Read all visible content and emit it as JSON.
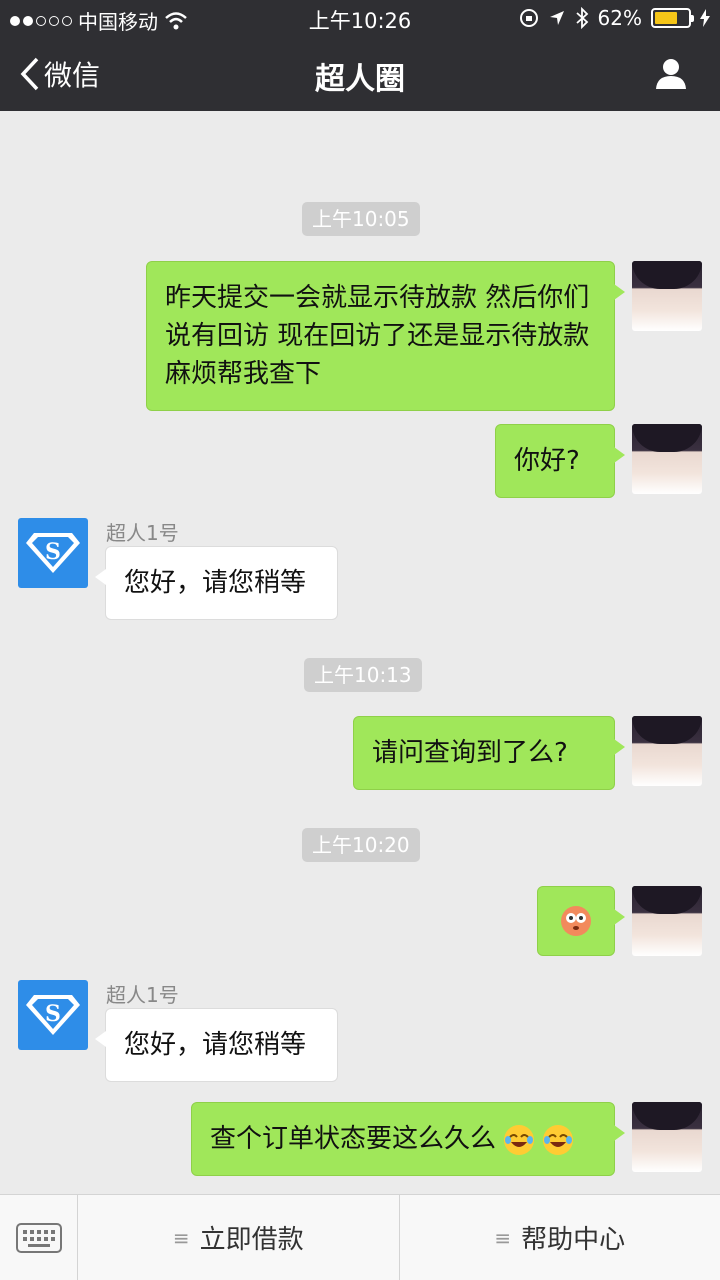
{
  "status_bar": {
    "carrier": "中国移动",
    "time": "上午10:26",
    "battery": "62%",
    "battery_level": 0.62
  },
  "nav": {
    "back_label": "微信",
    "title": "超人圈",
    "back_icon": "chevron-left-icon",
    "profile_icon": "person-icon"
  },
  "chat": {
    "timestamps": [
      "上午10:05",
      "上午10:13",
      "上午10:20"
    ],
    "messages": [
      {
        "from": "me",
        "text": "昨天提交一会就显示待放款 然后你们说有回访 现在回访了还是显示待放款 麻烦帮我查下"
      },
      {
        "from": "me",
        "text": "你好?"
      },
      {
        "from": "bot",
        "sender": "超人1号",
        "text": "您好，请您稍等"
      },
      {
        "from": "me",
        "text": "请问查询到了么?"
      },
      {
        "from": "me",
        "text": "",
        "emoji": "flushed-face-icon"
      },
      {
        "from": "bot",
        "sender": "超人1号",
        "text": "您好，请您稍等"
      },
      {
        "from": "me",
        "text": "查个订单状态要这么久么",
        "emoji": "crying-laughing-icon"
      }
    ]
  },
  "bottom_menu": {
    "keyboard_icon": "keyboard-icon",
    "items": [
      "立即借款",
      "帮助中心"
    ]
  },
  "colors": {
    "header_bg": "#2f2f33",
    "outgoing_bubble": "#a0e75a",
    "incoming_bubble": "#ffffff",
    "chat_bg": "#ebebeb"
  }
}
